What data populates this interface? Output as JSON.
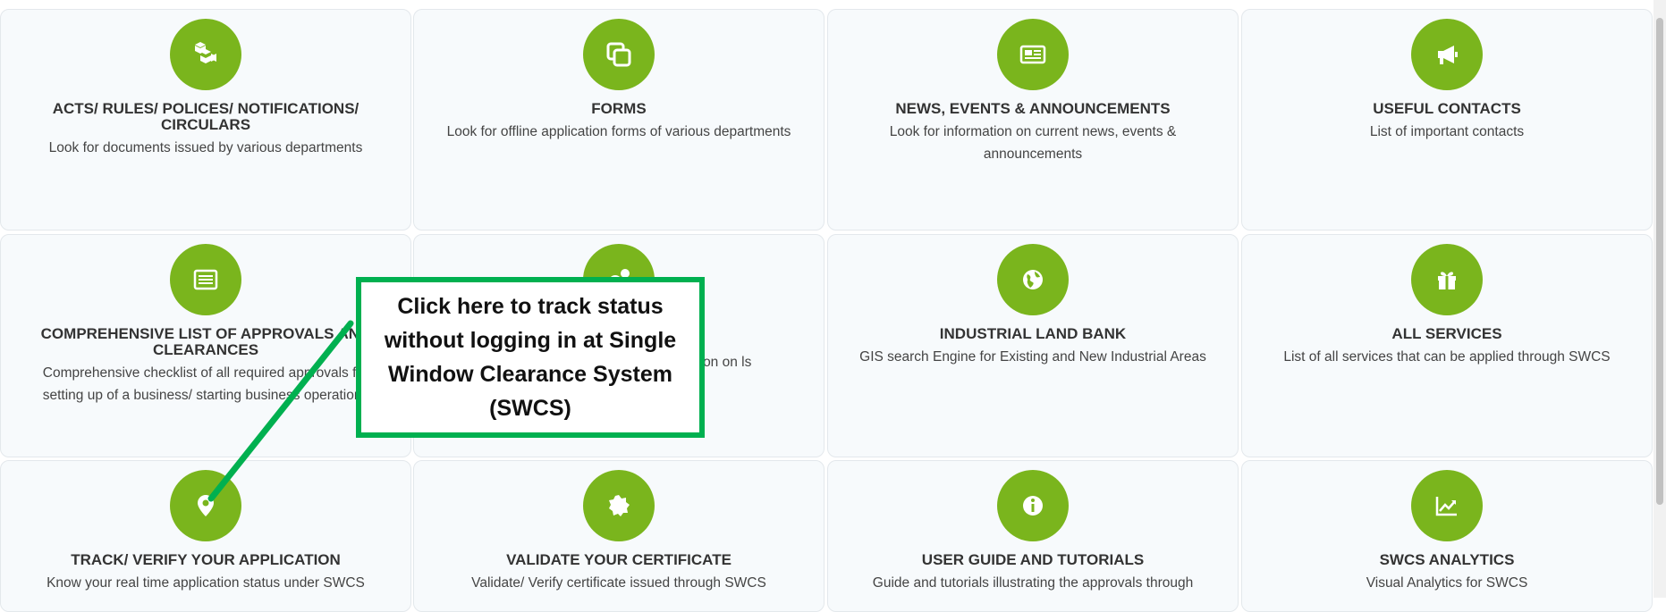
{
  "theme": {
    "accent": "#7ab51d",
    "callout_border": "#00b050",
    "card_bg": "#f7fafc"
  },
  "cards": [
    {
      "icon": "cubes-icon",
      "title": "ACTS/ RULES/ POLICES/ NOTIFICATIONS/ CIRCULARS",
      "desc": "Look for documents issued by various departments"
    },
    {
      "icon": "copy-icon",
      "title": "FORMS",
      "desc": "Look for offline application forms of various departments"
    },
    {
      "icon": "newspaper-icon",
      "title": "NEWS, EVENTS & ANNOUNCEMENTS",
      "desc": "Look for information on current news, events & announcements"
    },
    {
      "icon": "megaphone-icon",
      "title": "USEFUL CONTACTS",
      "desc": "List of important contacts"
    },
    {
      "icon": "list-icon",
      "title": "COMPREHENSIVE LIST OF APPROVALS AND CLEARANCES",
      "desc": "Comprehensive checklist of all required approvals for setting up of a business/ starting business operations"
    },
    {
      "icon": "gears-icon",
      "title": "",
      "desc": "ormation on ls"
    },
    {
      "icon": "globe-icon",
      "title": "INDUSTRIAL LAND BANK",
      "desc": "GIS search Engine for Existing and New Industrial Areas"
    },
    {
      "icon": "gift-icon",
      "title": "ALL SERVICES",
      "desc": "List of all services that can be applied through SWCS"
    },
    {
      "icon": "map-marker-icon",
      "title": "TRACK/ VERIFY YOUR APPLICATION",
      "desc": "Know your real time application status under SWCS"
    },
    {
      "icon": "certificate-icon",
      "title": "VALIDATE YOUR CERTIFICATE",
      "desc": "Validate/ Verify certificate issued through SWCS"
    },
    {
      "icon": "info-icon",
      "title": "USER GUIDE AND TUTORIALS",
      "desc": "Guide and tutorials illustrating the approvals through"
    },
    {
      "icon": "chart-icon",
      "title": "SWCS ANALYTICS",
      "desc": "Visual Analytics for SWCS"
    }
  ],
  "callout": {
    "text": "Click here to track status without logging in at Single Window Clearance System (SWCS)"
  }
}
